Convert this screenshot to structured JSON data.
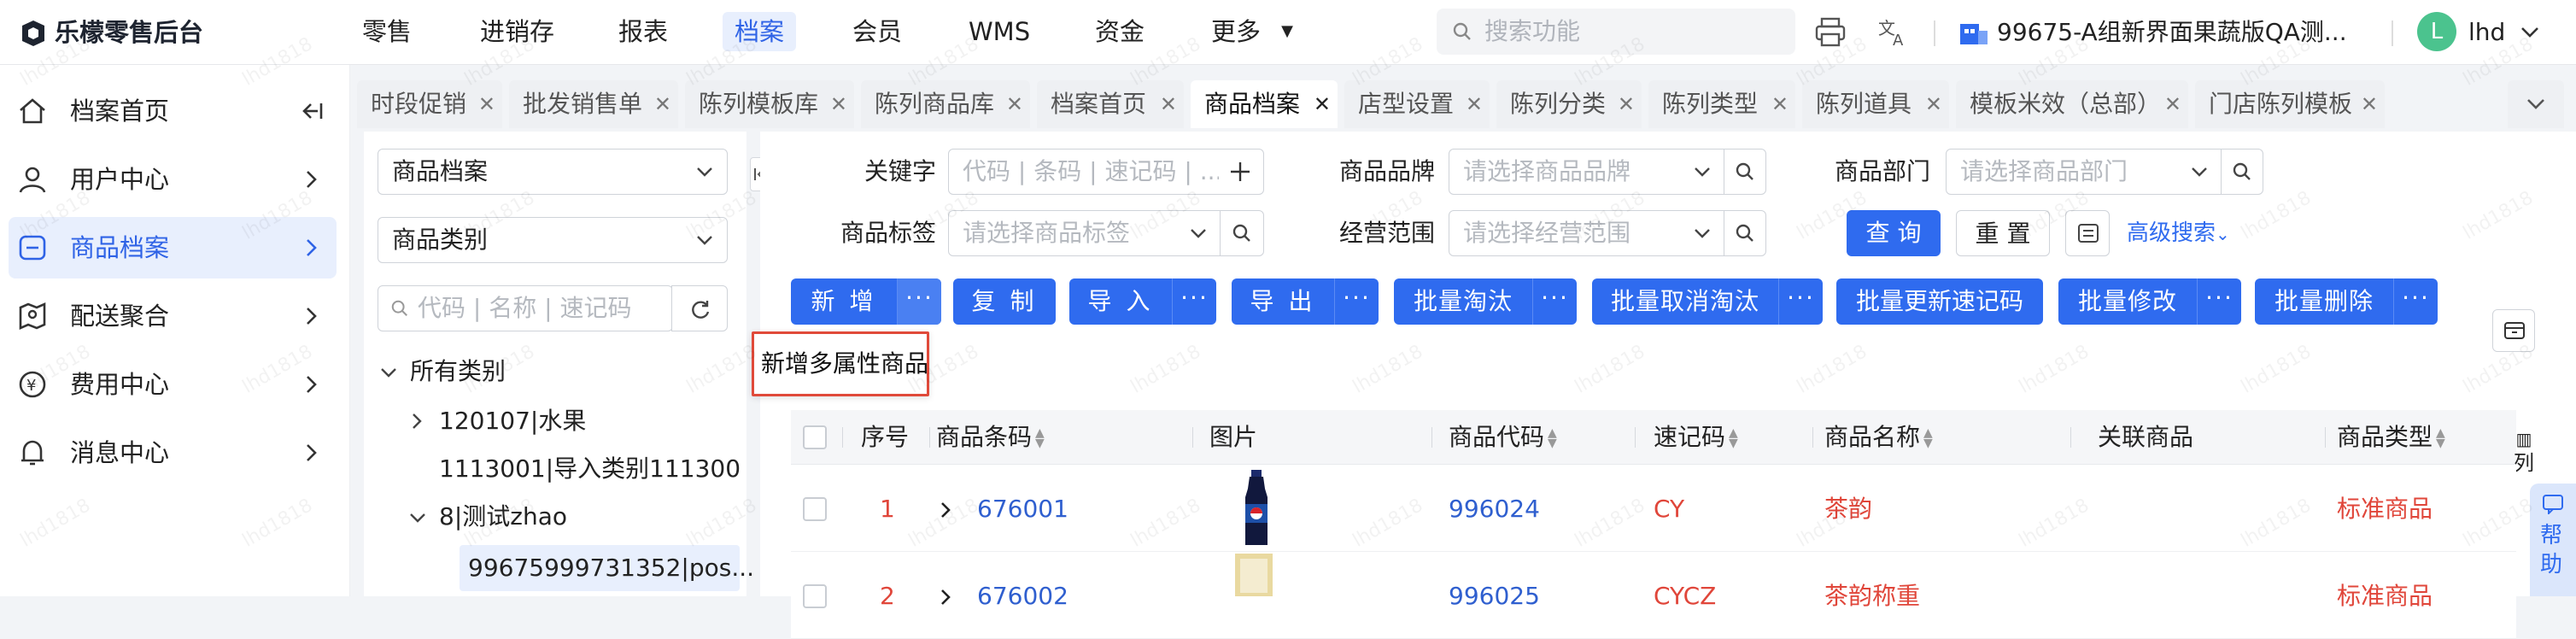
{
  "app": {
    "title": "乐檬零售后台"
  },
  "nav": {
    "items": [
      "零售",
      "进销存",
      "报表",
      "档案",
      "会员",
      "WMS",
      "资金",
      "更多"
    ],
    "active_index": 3,
    "search_placeholder": "搜索功能",
    "store_name": "99675-A组新界面果蔬版QA测...",
    "user_initial": "L",
    "user_name": "lhd"
  },
  "sidebar": {
    "items": [
      {
        "label": "档案首页",
        "icon": "home-icon"
      },
      {
        "label": "用户中心",
        "icon": "user-icon"
      },
      {
        "label": "商品档案",
        "icon": "minus-box-icon"
      },
      {
        "label": "配送聚合",
        "icon": "map-icon"
      },
      {
        "label": "费用中心",
        "icon": "yen-icon"
      },
      {
        "label": "消息中心",
        "icon": "bell-icon"
      }
    ],
    "active_index": 2
  },
  "tabs": [
    "时段促销",
    "批发销售单",
    "陈列模板库",
    "陈列商品库",
    "档案首页",
    "商品档案",
    "店型设置",
    "陈列分类",
    "陈列类型",
    "陈列道具",
    "模板米效（总部）",
    "门店陈列模板"
  ],
  "active_tab_index": 5,
  "tree": {
    "select1": "商品档案",
    "select2": "商品类别",
    "search_placeholder": "代码 | 名称 | 速记码",
    "nodes": [
      "所有类别",
      "120107|水果",
      "1113001|导入类别111300",
      "8|测试zhao",
      "99675999731352|pos..."
    ]
  },
  "filters": {
    "keyword_label": "关键字",
    "keyword_placeholder": "代码 | 条码 | 速记码 | ...",
    "brand_label": "商品品牌",
    "brand_placeholder": "请选择商品品牌",
    "dept_label": "商品部门",
    "dept_placeholder": "请选择商品部门",
    "tag_label": "商品标签",
    "tag_placeholder": "请选择商品标签",
    "scope_label": "经营范围",
    "scope_placeholder": "请选择经营范围",
    "query": "查 询",
    "reset": "重 置",
    "advanced": "高级搜索"
  },
  "toolbar": {
    "add": "新 增",
    "copy": "复 制",
    "import": "导 入",
    "export": "导 出",
    "batch_retire": "批量淘汰",
    "batch_unretire": "批量取消淘汰",
    "batch_update_code": "批量更新速记码",
    "batch_modify": "批量修改",
    "batch_delete": "批量删除",
    "more": "···"
  },
  "popup": {
    "label": "新增多属性商品"
  },
  "table": {
    "columns": [
      "序号",
      "商品条码",
      "图片",
      "商品代码",
      "速记码",
      "商品名称",
      "关联商品",
      "商品类型"
    ],
    "column_toggle": "列",
    "rows": [
      {
        "seq": "1",
        "barcode": "676001",
        "code": "996024",
        "shortcode": "CY",
        "name": "茶韵",
        "type": "标准商品"
      },
      {
        "seq": "2",
        "barcode": "676002",
        "code": "996025",
        "shortcode": "CYCZ",
        "name": "茶韵称重",
        "type": "标准商品"
      }
    ]
  },
  "help": "帮助",
  "watermark": "lhd1818",
  "colors": {
    "primary": "#2f6bef",
    "active_bg": "#e8effd",
    "red": "#e0463a",
    "link": "#2f5fcf"
  }
}
